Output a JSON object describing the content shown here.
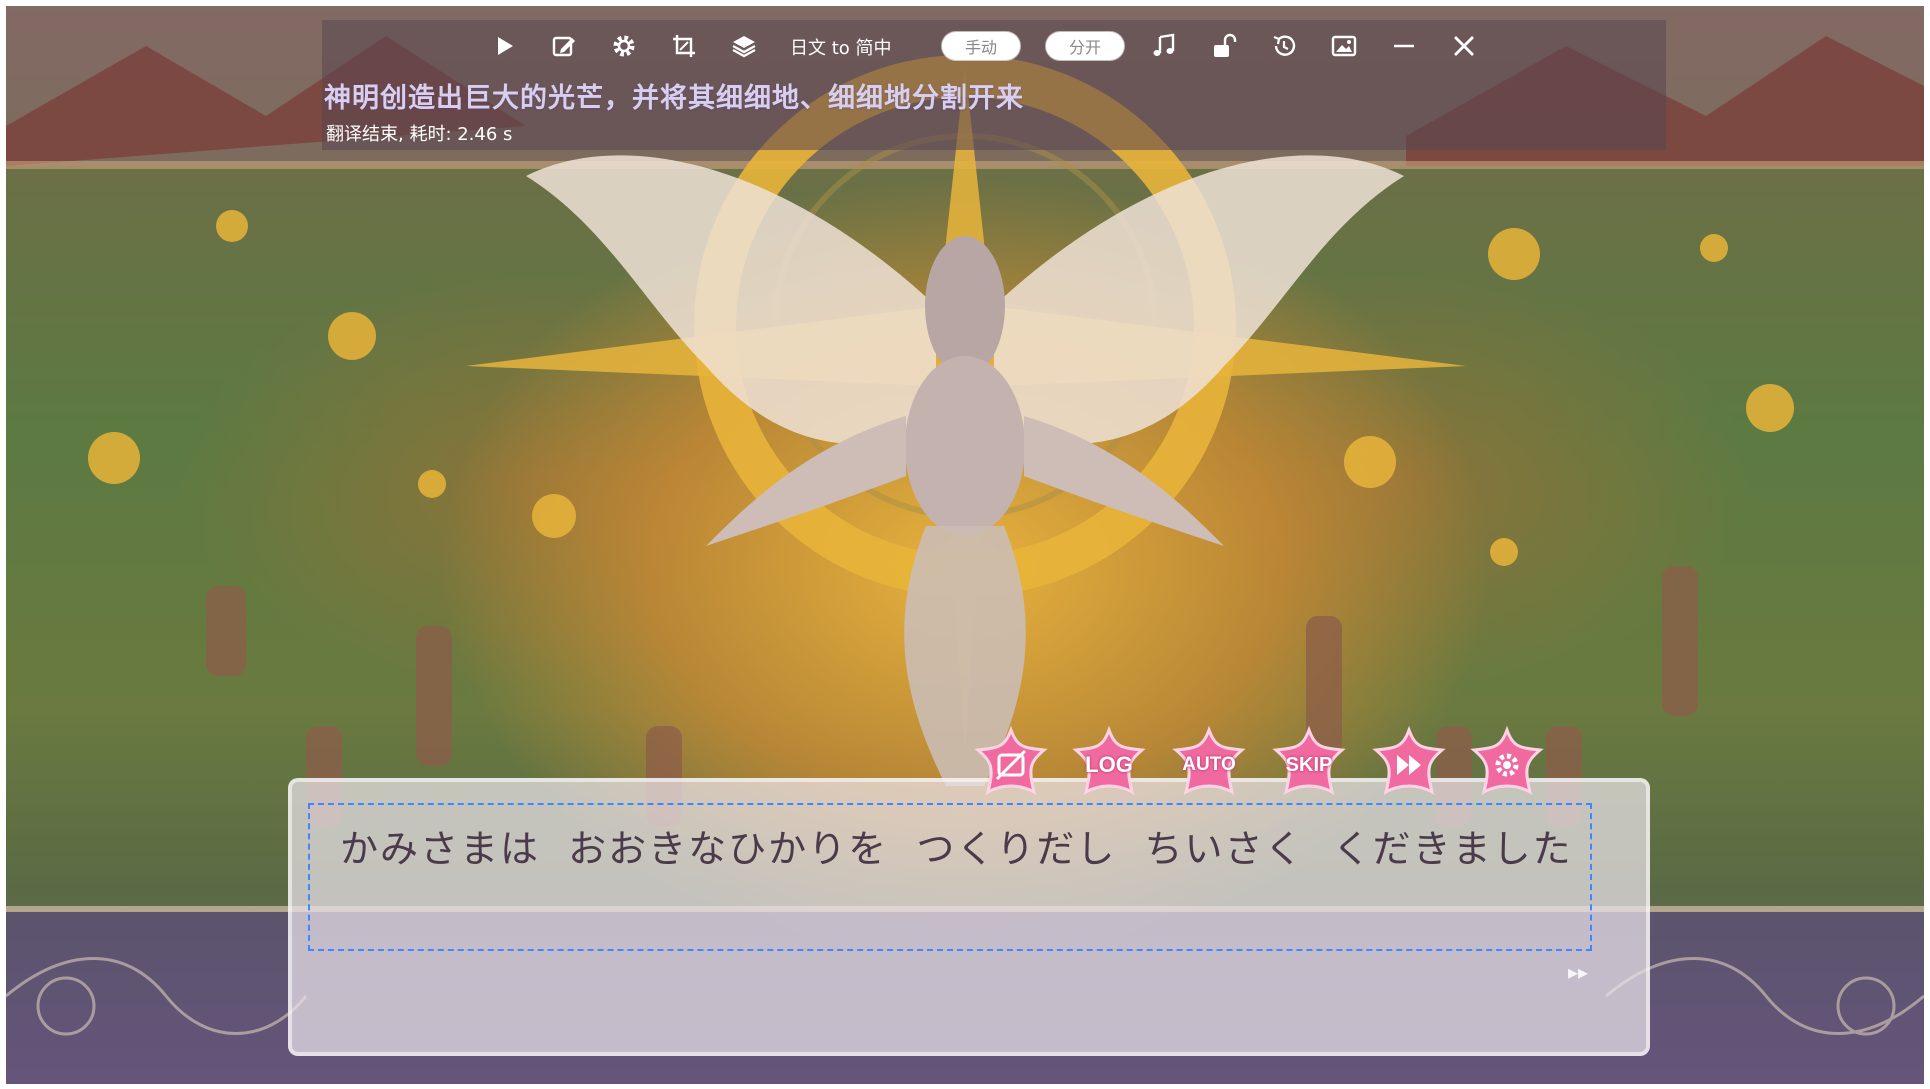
{
  "toolbar": {
    "buttons": [
      {
        "name": "play-icon"
      },
      {
        "name": "edit-icon"
      },
      {
        "name": "gear-icon"
      },
      {
        "name": "crop-icon"
      },
      {
        "name": "layers-icon"
      }
    ],
    "language_pair": "日文  to  简中",
    "manual_toggle": "手动",
    "split_toggle": "分开",
    "right_buttons": [
      {
        "name": "music-note-icon"
      },
      {
        "name": "unlock-icon"
      },
      {
        "name": "history-icon"
      },
      {
        "name": "image-icon"
      },
      {
        "name": "minimize-icon"
      },
      {
        "name": "close-icon"
      }
    ]
  },
  "translation": {
    "text": "神明创造出巨大的光芒，并将其细细地、细细地分割开来",
    "status": "翻译结束, 耗时: 2.46 s"
  },
  "game_menu": {
    "buttons": [
      {
        "name": "hide-window-icon",
        "label": ""
      },
      {
        "name": "log-button",
        "label": "LOG"
      },
      {
        "name": "auto-button",
        "label": "AUTO"
      },
      {
        "name": "skip-button",
        "label": "SKIP"
      },
      {
        "name": "fast-forward-icon",
        "label": ""
      },
      {
        "name": "settings-icon",
        "label": ""
      }
    ],
    "accent_color": "#f06aa0"
  },
  "dialogue": {
    "text": "かみさまは  おおきなひかりを  つくりだし  ちいさく  くだきました"
  },
  "colors": {
    "capture_border": "#3f86ff",
    "translation_text": "#d8cff0"
  }
}
